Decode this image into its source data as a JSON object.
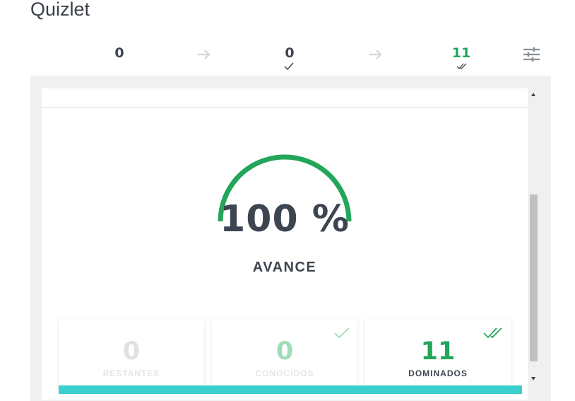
{
  "app": {
    "title": "Quizlet"
  },
  "counters": {
    "remaining": "0",
    "known": "0",
    "mastered": "11"
  },
  "progress": {
    "percent_text": "100 %",
    "value": 1.0,
    "label": "AVANCE"
  },
  "stats": [
    {
      "number": "0",
      "label": "RESTANTES"
    },
    {
      "number": "0",
      "label": "CONOCIDOS"
    },
    {
      "number": "11",
      "label": "DOMINADOS"
    }
  ],
  "colors": {
    "accent_green": "#23a55a",
    "teal": "#3ccfcf",
    "text_dark": "#3d4550"
  },
  "icons": {
    "arrow": "arrow-right-icon",
    "check": "check-icon",
    "double_check": "double-check-icon",
    "settings": "sliders-icon"
  }
}
